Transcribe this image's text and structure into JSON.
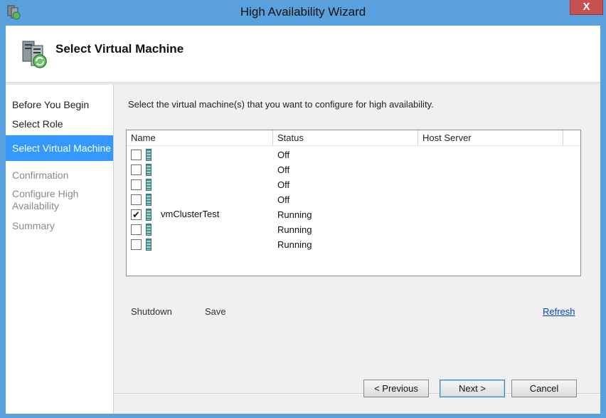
{
  "window": {
    "title": "High Availability Wizard",
    "close_label": "X",
    "accent": "#5aa0dc"
  },
  "header": {
    "title": "Select Virtual Machine",
    "icon": "server-cluster-icon"
  },
  "nav": {
    "items": [
      {
        "label": "Before You Begin",
        "state": "done"
      },
      {
        "label": "Select Role",
        "state": "done"
      },
      {
        "label": "Select Virtual Machine",
        "state": "active"
      },
      {
        "label": "Confirmation",
        "state": "pending"
      },
      {
        "label": "Configure High Availability",
        "state": "pending"
      },
      {
        "label": "Summary",
        "state": "pending"
      }
    ],
    "active_color": "#3399ff"
  },
  "main": {
    "instruction": "Select the virtual machine(s) that you want to configure for high availability.",
    "columns": [
      "Name",
      "Status",
      "Host Server"
    ],
    "rows": [
      {
        "checked": false,
        "name": "",
        "status": "Off",
        "host": ""
      },
      {
        "checked": false,
        "name": "",
        "status": "Off",
        "host": ""
      },
      {
        "checked": false,
        "name": "",
        "status": "Off",
        "host": ""
      },
      {
        "checked": false,
        "name": "",
        "status": "Off",
        "host": ""
      },
      {
        "checked": true,
        "name": "vmClusterTest",
        "status": "Running",
        "host": ""
      },
      {
        "checked": false,
        "name": "",
        "status": "Running",
        "host": ""
      },
      {
        "checked": false,
        "name": "",
        "status": "Running",
        "host": ""
      }
    ],
    "actions": {
      "shutdown": "Shutdown",
      "save": "Save",
      "refresh": "Refresh"
    }
  },
  "buttons": {
    "previous": "< Previous",
    "next": "Next >",
    "cancel": "Cancel"
  }
}
